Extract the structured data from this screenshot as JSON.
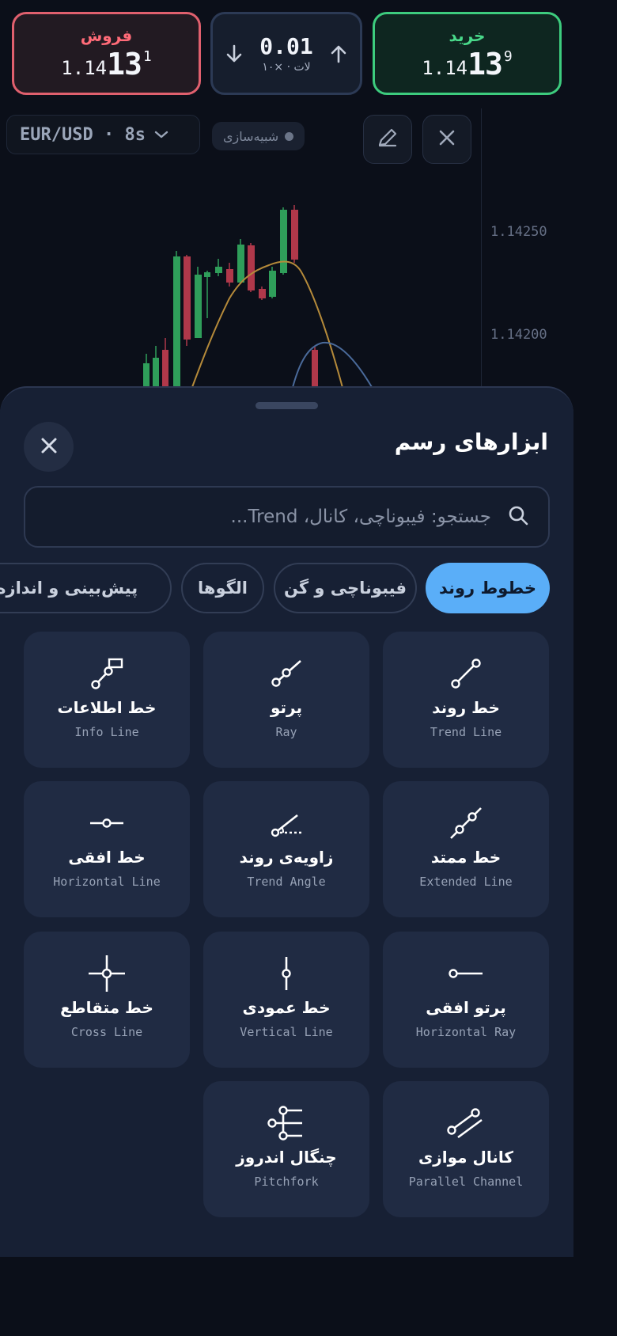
{
  "quote_bar": {
    "sell": {
      "label": "فروش",
      "price_small": "1.14",
      "price_big": "13",
      "price_sup": "1"
    },
    "lot": {
      "value": "0.01",
      "unit": "لات · ×۱۰"
    },
    "buy": {
      "label": "خرید",
      "price_small": "1.14",
      "price_big": "13",
      "price_sup": "9"
    }
  },
  "chart": {
    "symbol": "EUR/USD · 8s",
    "mode_badge": "شبیه‌سازی",
    "axis_labels": [
      "1.14250",
      "1.14200"
    ],
    "colors": {
      "up": "#2f9e5a",
      "down": "#b0384a",
      "ma_fast": "#b58a3a",
      "ma_slow": "#4a6a9a"
    }
  },
  "drawing_sheet": {
    "title": "ابزارهای رسم",
    "search_placeholder": "جستجو: فیبوناچی، کانال، Trend...",
    "tabs": [
      {
        "label": "خطوط روند",
        "active": true
      },
      {
        "label": "فیبوناچی و گن",
        "active": false
      },
      {
        "label": "الگوها",
        "active": false
      },
      {
        "label": "پیش‌بینی و اندازه‌گیری",
        "active": false
      }
    ],
    "tools": [
      {
        "fa": "خط روند",
        "en": "Trend Line",
        "icon": "trend-line-icon"
      },
      {
        "fa": "پرتو",
        "en": "Ray",
        "icon": "ray-icon"
      },
      {
        "fa": "خط اطلاعات",
        "en": "Info Line",
        "icon": "info-line-icon"
      },
      {
        "fa": "خط ممتد",
        "en": "Extended Line",
        "icon": "extended-line-icon"
      },
      {
        "fa": "زاویه‌ی روند",
        "en": "Trend Angle",
        "icon": "trend-angle-icon"
      },
      {
        "fa": "خط افقی",
        "en": "Horizontal Line",
        "icon": "horizontal-line-icon"
      },
      {
        "fa": "پرتو افقی",
        "en": "Horizontal Ray",
        "icon": "horizontal-ray-icon"
      },
      {
        "fa": "خط عمودی",
        "en": "Vertical Line",
        "icon": "vertical-line-icon"
      },
      {
        "fa": "خط متقاطع",
        "en": "Cross Line",
        "icon": "cross-line-icon"
      },
      {
        "fa": "کانال موازی",
        "en": "Parallel Channel",
        "icon": "parallel-channel-icon"
      },
      {
        "fa": "چنگال اندروز",
        "en": "Pitchfork",
        "icon": "pitchfork-icon"
      }
    ]
  }
}
